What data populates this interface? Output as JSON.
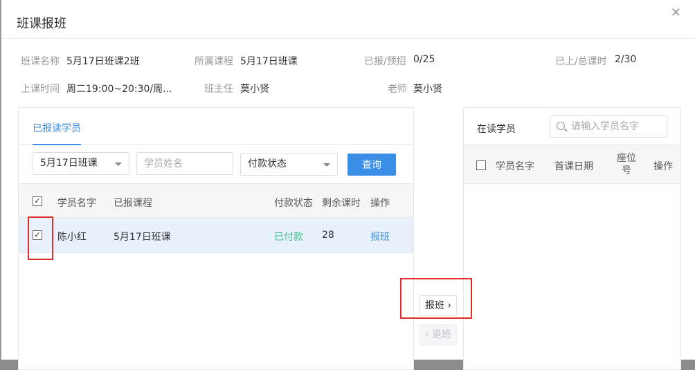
{
  "dialog": {
    "title": "班课报班"
  },
  "info": {
    "class_name_label": "班课名称",
    "class_name": "5月17日班课2班",
    "course_label": "所属课程",
    "course": "5月17日班课",
    "enrolled_label": "已报/预招",
    "enrolled": "0/25",
    "lessons_label": "已上/总课时",
    "lessons": "2/30",
    "schedule_label": "上课时间",
    "schedule": "周二19:00~20:30/周...",
    "head_teacher_label": "班主任",
    "head_teacher": "莫小贤",
    "teacher_label": "老师",
    "teacher": "莫小贤"
  },
  "left_panel": {
    "tab_label": "已报读学员",
    "filters": {
      "course_select": "5月17日班课",
      "name_placeholder": "学员姓名",
      "payment_select": "付款状态",
      "query_button": "查询"
    },
    "columns": [
      "学员名字",
      "已报课程",
      "付款状态",
      "剩余课时",
      "操作"
    ],
    "rows": [
      {
        "checked": true,
        "name": "陈小红",
        "course": "5月17日班课",
        "payment": "已付款",
        "remaining": "28",
        "action": "报班"
      }
    ]
  },
  "transfer": {
    "enroll_button": "报班",
    "withdraw_button": "退班"
  },
  "right_panel": {
    "title": "在读学员",
    "search_placeholder": "请输入学员名字",
    "columns": [
      "学员名字",
      "首课日期",
      "座位号",
      "操作"
    ]
  },
  "colors": {
    "accent": "#3a8ee6",
    "paid": "#3fb983",
    "highlight": "#e02b2b"
  }
}
